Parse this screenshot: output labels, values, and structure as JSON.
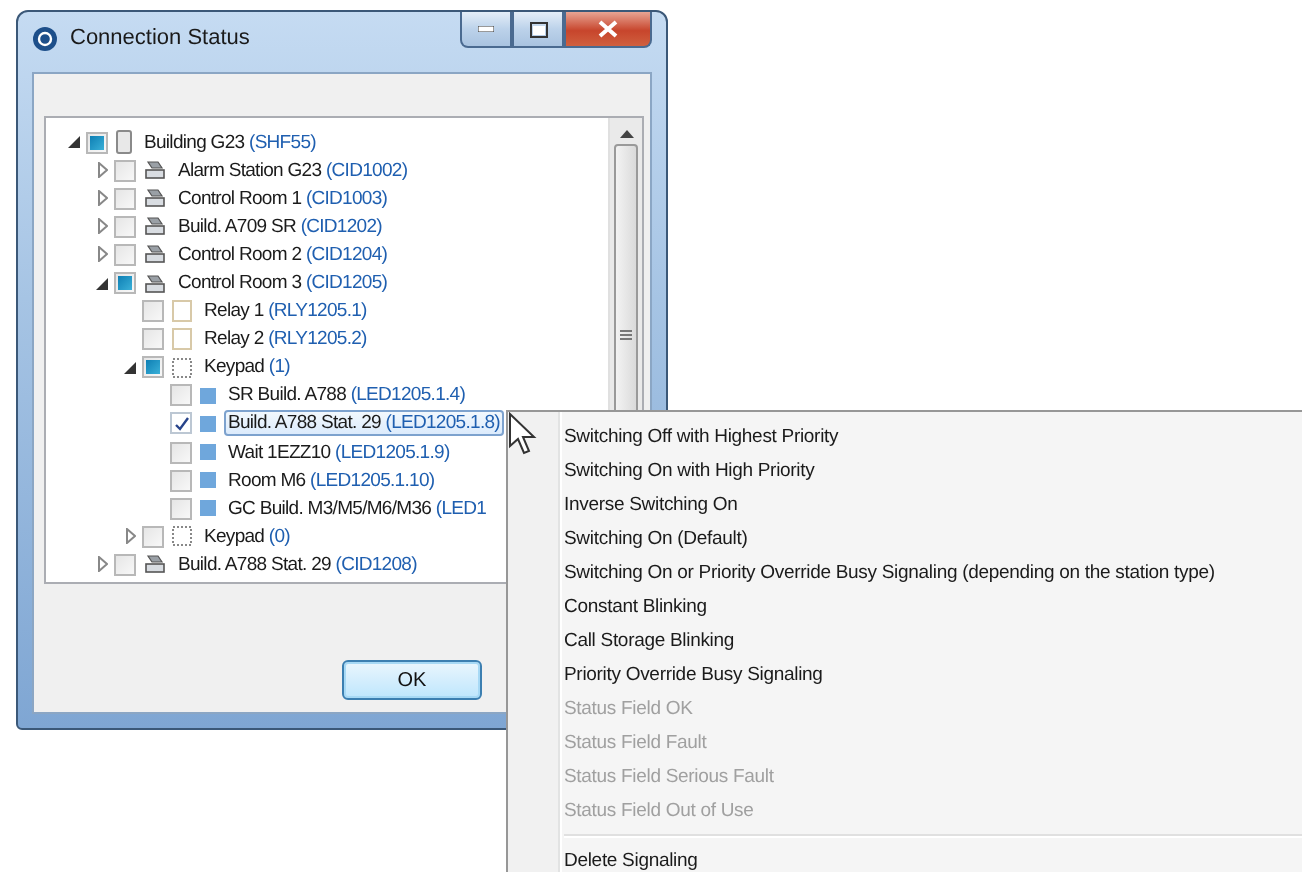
{
  "window": {
    "title": "Connection Status"
  },
  "tree": [
    {
      "label": "Building G23",
      "code": "(SHF55)",
      "kind": "building",
      "expanded": true,
      "checked": false,
      "partial": true,
      "selected": false,
      "children": [
        {
          "label": "Alarm Station G23",
          "code": "(CID1002)",
          "kind": "station",
          "expanded": false,
          "checked": false,
          "partial": false,
          "selected": false
        },
        {
          "label": "Control Room 1",
          "code": "(CID1003)",
          "kind": "station",
          "expanded": false,
          "checked": false,
          "partial": false,
          "selected": false
        },
        {
          "label": "Build. A709 SR",
          "code": "(CID1202)",
          "kind": "station",
          "expanded": false,
          "checked": false,
          "partial": false,
          "selected": false
        },
        {
          "label": "Control Room 2",
          "code": "(CID1204)",
          "kind": "station",
          "expanded": false,
          "checked": false,
          "partial": false,
          "selected": false
        },
        {
          "label": "Control Room 3",
          "code": "(CID1205)",
          "kind": "station",
          "expanded": true,
          "checked": false,
          "partial": true,
          "selected": false,
          "children": [
            {
              "label": "Relay 1",
              "code": "(RLY1205.1)",
              "kind": "relay",
              "checked": false,
              "partial": false,
              "selected": false
            },
            {
              "label": "Relay 2",
              "code": "(RLY1205.2)",
              "kind": "relay",
              "checked": false,
              "partial": false,
              "selected": false
            },
            {
              "label": "Keypad",
              "code": "(1)",
              "kind": "keypad",
              "expanded": true,
              "checked": false,
              "partial": true,
              "selected": false,
              "children": [
                {
                  "label": "SR Build. A788",
                  "code": "(LED1205.1.4)",
                  "kind": "led",
                  "checked": false,
                  "partial": false,
                  "selected": false
                },
                {
                  "label": "Build. A788 Stat. 29",
                  "code": "(LED1205.1.8)",
                  "kind": "led",
                  "checked": true,
                  "partial": false,
                  "selected": true
                },
                {
                  "label": "Wait 1EZZ10",
                  "code": "(LED1205.1.9)",
                  "kind": "led",
                  "checked": false,
                  "partial": false,
                  "selected": false
                },
                {
                  "label": "Room M6",
                  "code": "(LED1205.1.10)",
                  "kind": "led",
                  "checked": false,
                  "partial": false,
                  "selected": false
                },
                {
                  "label": "GC Build. M3/M5/M6/M36",
                  "code": "(LED1",
                  "kind": "led",
                  "checked": false,
                  "partial": false,
                  "selected": false
                }
              ]
            },
            {
              "label": "Keypad",
              "code": "(0)",
              "kind": "keypad",
              "expanded": false,
              "checked": false,
              "partial": false,
              "selected": false
            }
          ]
        },
        {
          "label": "Build. A788 Stat. 29",
          "code": "(CID1208)",
          "kind": "station",
          "expanded": false,
          "checked": false,
          "partial": false,
          "selected": false
        }
      ]
    }
  ],
  "buttons": [
    "OK"
  ],
  "context_menu": {
    "groups": [
      [
        {
          "label": "Switching Off with Highest Priority",
          "disabled": false
        },
        {
          "label": "Switching On with High Priority",
          "disabled": false
        },
        {
          "label": "Inverse Switching On",
          "disabled": false
        },
        {
          "label": "Switching On (Default)",
          "disabled": false
        },
        {
          "label": "Switching On or Priority Override Busy Signaling (depending on the station type)",
          "disabled": false
        },
        {
          "label": "Constant Blinking",
          "disabled": false
        },
        {
          "label": "Call Storage Blinking",
          "disabled": false
        },
        {
          "label": "Priority Override Busy Signaling",
          "disabled": false
        },
        {
          "label": "Status Field OK",
          "disabled": true
        },
        {
          "label": "Status Field Fault",
          "disabled": true
        },
        {
          "label": "Status Field Serious Fault",
          "disabled": true
        },
        {
          "label": "Status Field Out of Use",
          "disabled": true
        }
      ],
      [
        {
          "label": "Delete Signaling",
          "disabled": false
        }
      ]
    ]
  }
}
